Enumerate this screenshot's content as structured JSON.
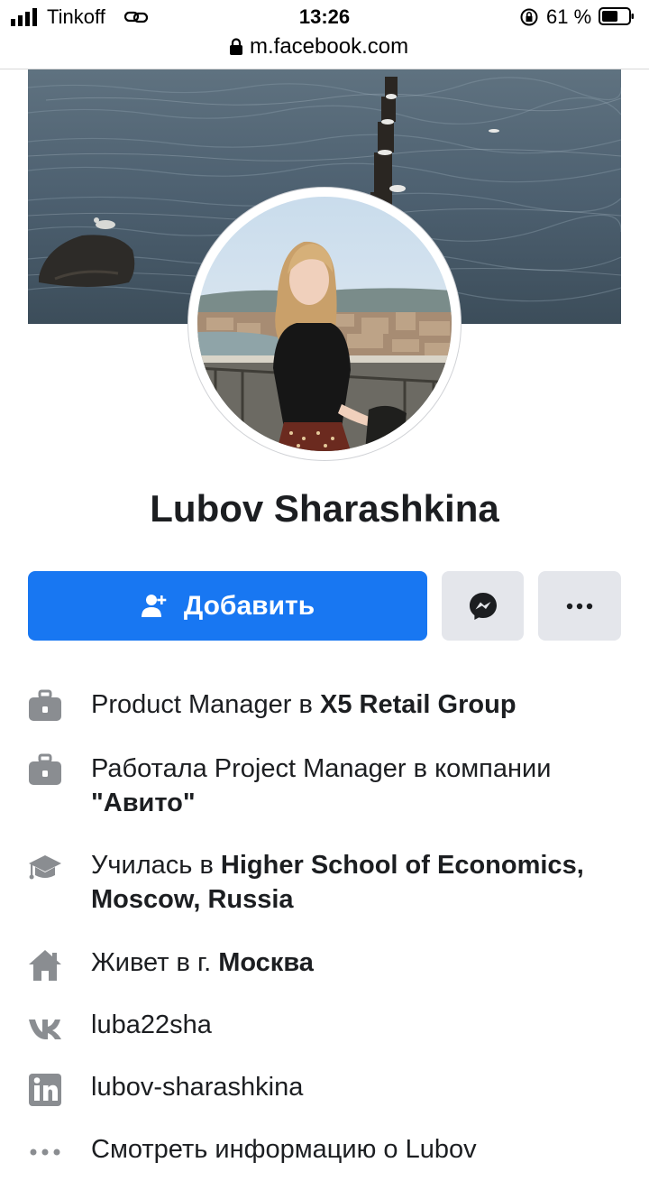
{
  "status_bar": {
    "carrier": "Tinkoff",
    "time": "13:26",
    "battery_percent": "61 %",
    "battery_level": 0.61
  },
  "browser": {
    "url": "m.facebook.com"
  },
  "profile": {
    "name": "Lubov Sharashkina",
    "add_friend_label": "Добавить"
  },
  "intro": {
    "work_current_prefix": "Product Manager в ",
    "work_current_company": "X5 Retail Group",
    "work_past_prefix": "Работала Project Manager в компании ",
    "work_past_company": "\"Авито\"",
    "education_prefix": "Училась в ",
    "education_school": "Higher School of Economics, Moscow, Russia",
    "lives_prefix": "Живет в г. ",
    "lives_city": "Москва",
    "vk": "luba22sha",
    "linkedin": "lubov-sharashkina",
    "see_about": "Смотреть информацию о Lubov"
  },
  "colors": {
    "accent": "#1877f2",
    "secondary_button": "#e4e6eb",
    "icon_gray": "#8a8d91",
    "text": "#1c1e21"
  }
}
